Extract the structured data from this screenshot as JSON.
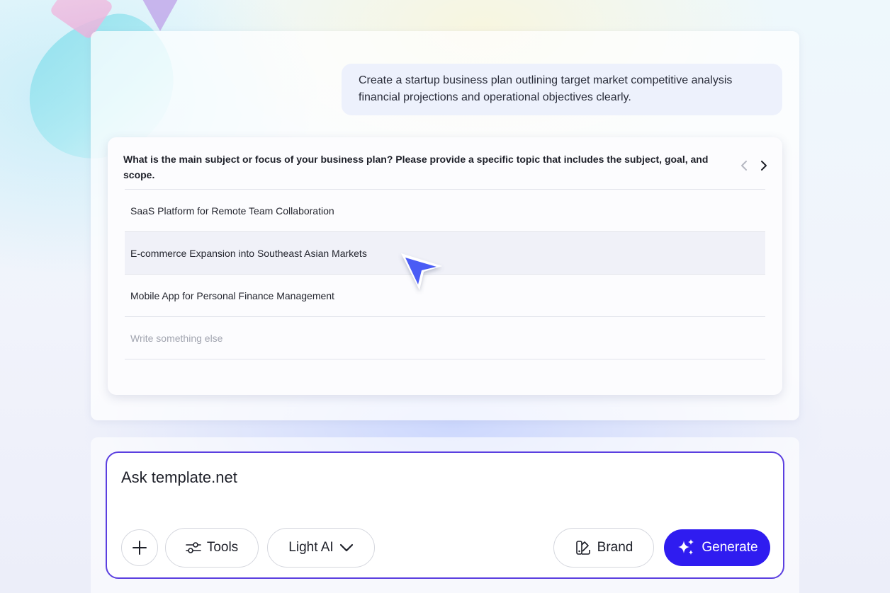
{
  "chat": {
    "user_message": "Create a startup business plan outlining target market competitive analysis financial projections and operational objectives clearly."
  },
  "question": {
    "text": "What is the main subject or focus of your business plan? Please provide a specific topic that includes the subject, goal, and scope.",
    "options": [
      "SaaS Platform for Remote Team Collaboration",
      "E-commerce Expansion into Southeast Asian Markets",
      "Mobile App for Personal Finance Management"
    ],
    "other_placeholder": "Write something else",
    "nav_prev_icon": "chevron-left-icon",
    "nav_next_icon": "chevron-right-icon"
  },
  "composer": {
    "placeholder": "Ask template.net",
    "add_icon": "plus-icon",
    "tools_label": "Tools",
    "tools_icon": "sliders-icon",
    "model_label": "Light AI",
    "model_icon": "chevron-down-icon",
    "brand_label": "Brand",
    "brand_icon": "palette-icon",
    "generate_label": "Generate",
    "generate_icon": "sparkles-icon"
  },
  "colors": {
    "accent": "#2f1cf0",
    "prompt_border": "#5b3fe0",
    "cursor": "#4a5cf5"
  }
}
